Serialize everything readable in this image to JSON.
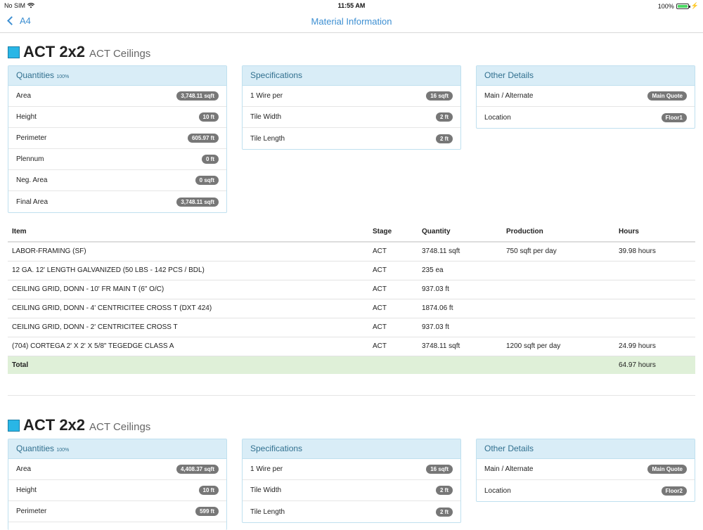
{
  "status": {
    "carrier": "No SIM",
    "time": "11:55 AM",
    "battery": "100%",
    "battery_level": 1.0
  },
  "nav": {
    "back_label": "A4",
    "title": "Material Information"
  },
  "sections": [
    {
      "title": "ACT 2x2",
      "subtitle": "ACT Ceilings",
      "swatch_color": "#29b6e6",
      "quantities": {
        "title": "Quantities",
        "pct": "100%",
        "rows": [
          {
            "label": "Area",
            "value": "3,748.11 sqft"
          },
          {
            "label": "Height",
            "value": "10 ft"
          },
          {
            "label": "Perimeter",
            "value": "605.97 ft"
          },
          {
            "label": "Plennum",
            "value": "0 ft"
          },
          {
            "label": "Neg. Area",
            "value": "0 sqft"
          },
          {
            "label": "Final Area",
            "value": "3,748.11 sqft"
          }
        ]
      },
      "specifications": {
        "title": "Specifications",
        "rows": [
          {
            "label": "1 Wire per",
            "value": "16 sqft"
          },
          {
            "label": "Tile Width",
            "value": "2 ft"
          },
          {
            "label": "Tile Length",
            "value": "2 ft"
          }
        ]
      },
      "other": {
        "title": "Other Details",
        "rows": [
          {
            "label": "Main / Alternate",
            "value": "Main Quote"
          },
          {
            "label": "Location",
            "value": "Floor1"
          }
        ]
      },
      "table": {
        "headers": [
          "Item",
          "Stage",
          "Quantity",
          "Production",
          "Hours"
        ],
        "rows": [
          [
            "LABOR-FRAMING (SF)",
            "ACT",
            "3748.11 sqft",
            "750 sqft per day",
            "39.98 hours"
          ],
          [
            "12 GA. 12' LENGTH GALVANIZED (50 LBS - 142 PCS / BDL)",
            "ACT",
            "235 ea",
            "",
            ""
          ],
          [
            "CEILING GRID, DONN - 10' FR MAIN T (6\" O/C)",
            "ACT",
            "937.03 ft",
            "",
            ""
          ],
          [
            "CEILING GRID, DONN - 4' CENTRICITEE CROSS T (DXT 424)",
            "ACT",
            "1874.06 ft",
            "",
            ""
          ],
          [
            "CEILING GRID, DONN - 2' CENTRICITEE CROSS T",
            "ACT",
            "937.03 ft",
            "",
            ""
          ],
          [
            "(704) CORTEGA 2' X 2' X 5/8\" TEGEDGE CLASS A",
            "ACT",
            "3748.11 sqft",
            "1200 sqft per day",
            "24.99 hours"
          ]
        ],
        "total_label": "Total",
        "total_hours": "64.97 hours"
      }
    },
    {
      "title": "ACT 2x2",
      "subtitle": "ACT Ceilings",
      "swatch_color": "#29b6e6",
      "quantities": {
        "title": "Quantities",
        "pct": "100%",
        "rows": [
          {
            "label": "Area",
            "value": "4,408.37 sqft"
          },
          {
            "label": "Height",
            "value": "10 ft"
          },
          {
            "label": "Perimeter",
            "value": "599 ft"
          }
        ]
      },
      "specifications": {
        "title": "Specifications",
        "rows": [
          {
            "label": "1 Wire per",
            "value": "16 sqft"
          },
          {
            "label": "Tile Width",
            "value": "2 ft"
          },
          {
            "label": "Tile Length",
            "value": "2 ft"
          }
        ]
      },
      "other": {
        "title": "Other Details",
        "rows": [
          {
            "label": "Main / Alternate",
            "value": "Main Quote"
          },
          {
            "label": "Location",
            "value": "Floor2"
          }
        ]
      }
    }
  ]
}
